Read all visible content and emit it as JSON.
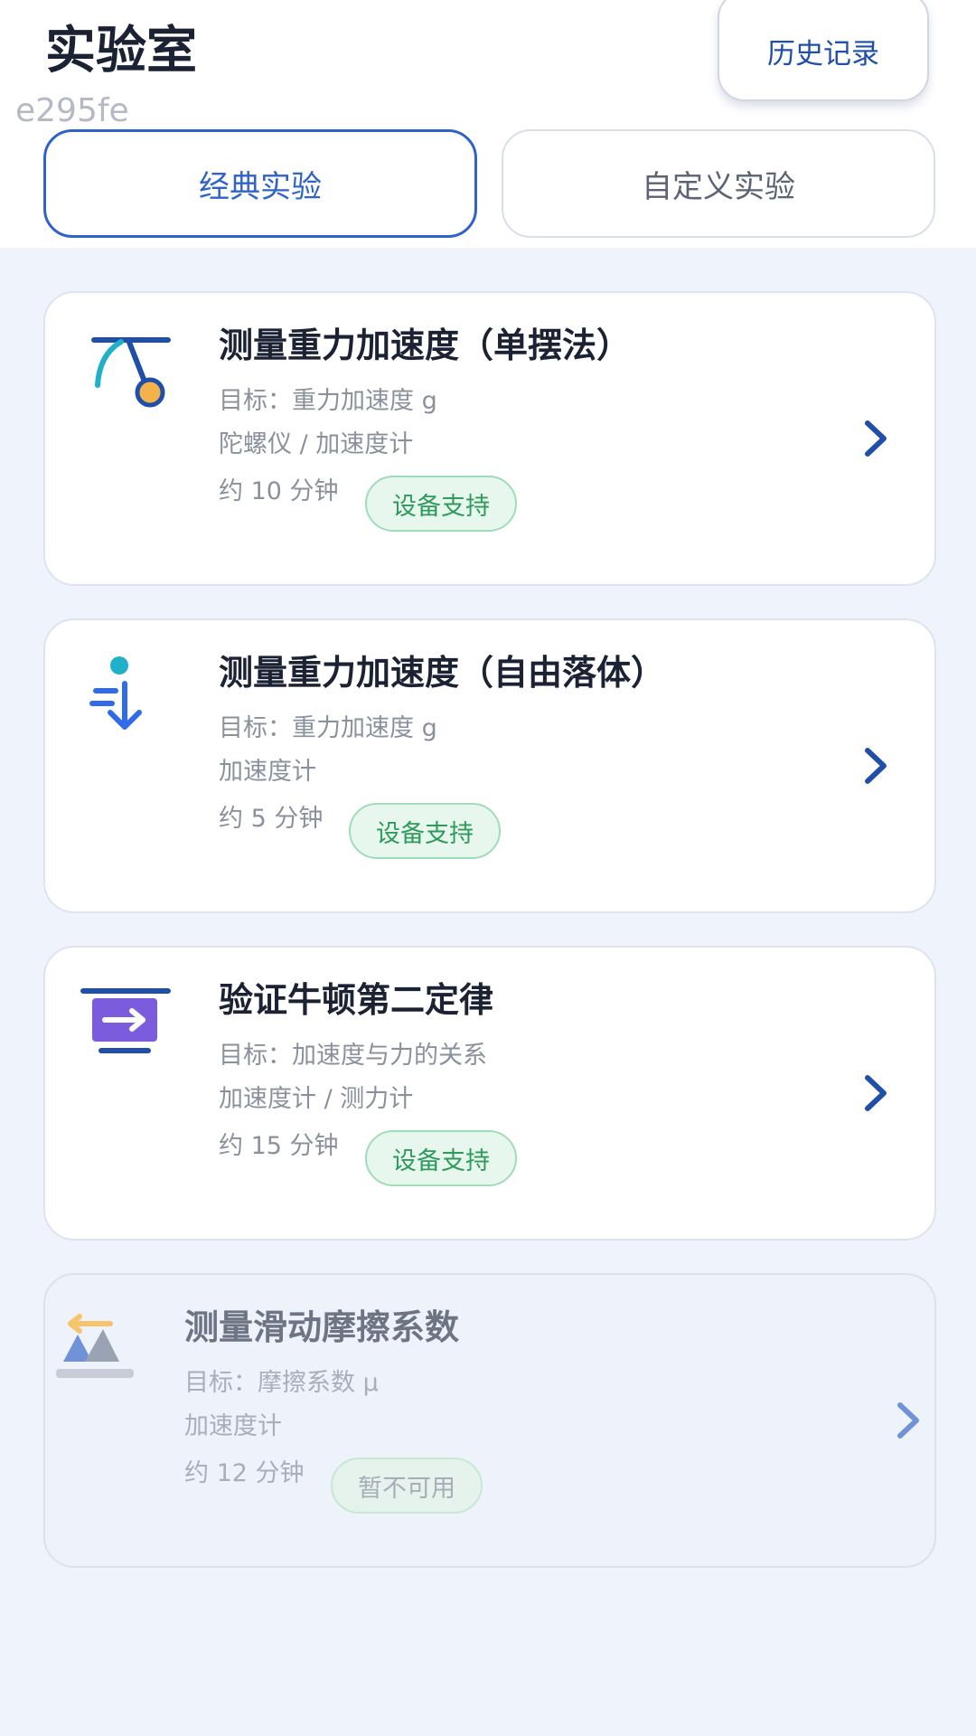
{
  "header": {
    "title": "实验室",
    "id_label": "e295fe",
    "history_label": "历史记录"
  },
  "tabs": [
    {
      "label": "经典实验",
      "selected": true
    },
    {
      "label": "自定义实验",
      "selected": false
    }
  ],
  "experiments": [
    {
      "title": "测量重力加速度（单摆法）",
      "goal": "目标：重力加速度 g",
      "sensors": "陀螺仪 / 加速度计",
      "time": "约 10 分钟",
      "badge": "设备支持",
      "icon": "pendulum-icon",
      "available": true
    },
    {
      "title": "测量重力加速度（自由落体）",
      "goal": "目标：重力加速度 g",
      "sensors": "加速度计",
      "time": "约 5 分钟",
      "badge": "设备支持",
      "icon": "free-fall-icon",
      "available": true
    },
    {
      "title": "验证牛顿第二定律",
      "goal": "目标：加速度与力的关系",
      "sensors": "加速度计 / 测力计",
      "time": "约 15 分钟",
      "badge": "设备支持",
      "icon": "force-cart-icon",
      "available": true
    },
    {
      "title": "测量滑动摩擦系数",
      "goal": "目标：摩擦系数 μ",
      "sensors": "加速度计",
      "time": "约 12 分钟",
      "badge": "暂不可用",
      "icon": "friction-slope-icon",
      "available": false
    }
  ],
  "colors": {
    "accent": "#2f63c9",
    "navy": "#1f4fa8",
    "success": "#2e9a5b",
    "background": "#eef3fc"
  }
}
